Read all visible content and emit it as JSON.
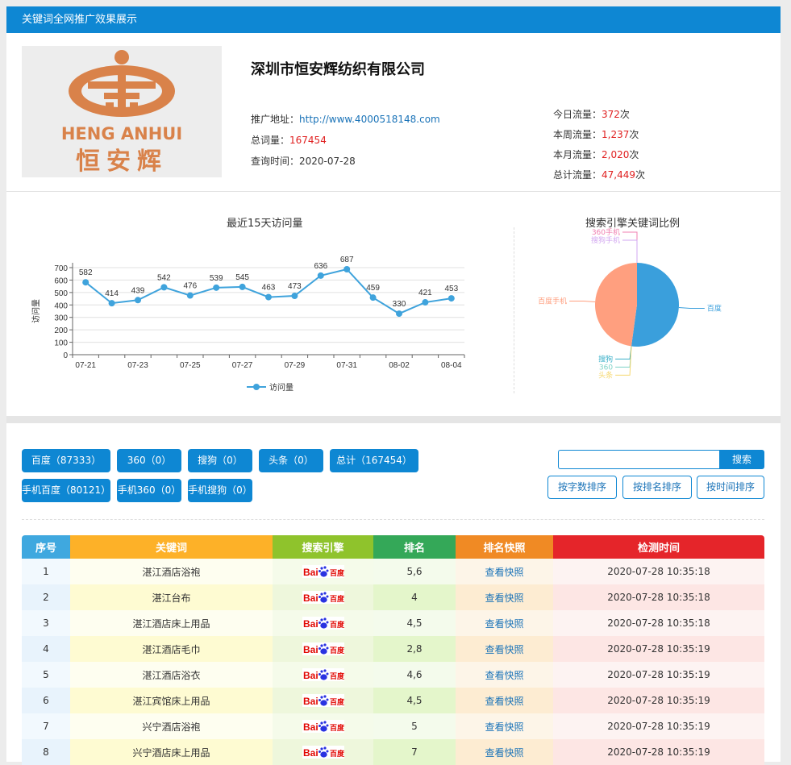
{
  "header": {
    "title": "关键词全网推广效果展示"
  },
  "company": {
    "name": "深圳市恒安辉纺织有限公司",
    "logo_text_en": "HENG ANHUI",
    "logo_text_cn": "恒安辉",
    "url_label": "推广地址：",
    "url": "http://www.4000518148.com",
    "total_words_label": "总词量：",
    "total_words": "167454",
    "query_time_label": "查询时间：",
    "query_time": "2020-07-28"
  },
  "traffic": [
    {
      "label": "今日流量：",
      "value": "372",
      "unit": "次"
    },
    {
      "label": "本周流量：",
      "value": "1,237",
      "unit": "次"
    },
    {
      "label": "本月流量：",
      "value": "2,020",
      "unit": "次"
    },
    {
      "label": "总计流量：",
      "value": "47,449",
      "unit": "次"
    }
  ],
  "chart_data": [
    {
      "type": "line",
      "title": "最近15天访问量",
      "ylabel": "访问量",
      "xlabel": "",
      "x": [
        "07-21",
        "07-22",
        "07-23",
        "07-24",
        "07-25",
        "07-26",
        "07-27",
        "07-28",
        "07-29",
        "07-30",
        "07-31",
        "08-01",
        "08-02",
        "08-03",
        "08-04"
      ],
      "x_tick_labels": [
        "07-21",
        "07-23",
        "07-25",
        "07-27",
        "07-29",
        "07-31",
        "08-02",
        "08-04"
      ],
      "y_ticks": [
        "0",
        "100",
        "200",
        "300",
        "400",
        "500",
        "600",
        "700"
      ],
      "series": [
        {
          "name": "访问量",
          "values": [
            582,
            414,
            439,
            542,
            476,
            539,
            545,
            463,
            473,
            636,
            687,
            459,
            330,
            421,
            453
          ],
          "color": "#3fa3dc"
        }
      ],
      "ylim": [
        0,
        700
      ],
      "grid": true,
      "legend": "bottom-center"
    },
    {
      "type": "pie",
      "title": "搜索引擎关键词比例",
      "slices": [
        {
          "label": "百度",
          "value": 87333,
          "color": "#3a9fdc"
        },
        {
          "label": "360",
          "value": 0,
          "color": "#7fd3c7"
        },
        {
          "label": "搜狗",
          "value": 0,
          "color": "#3ab0c9"
        },
        {
          "label": "头条",
          "value": 0,
          "color": "#f5d76e"
        },
        {
          "label": "百度手机",
          "value": 80121,
          "color": "#ff9f7f"
        },
        {
          "label": "360手机",
          "value": 0,
          "color": "#f07fb0"
        },
        {
          "label": "搜狗手机",
          "value": 0,
          "color": "#d2a7f0"
        }
      ],
      "legend": "none"
    }
  ],
  "filters": {
    "row1": [
      {
        "label": "百度（87333）"
      },
      {
        "label": "360（0）"
      },
      {
        "label": "搜狗（0）"
      },
      {
        "label": "头条（0）"
      },
      {
        "label": "总计（167454）"
      }
    ],
    "row2": [
      {
        "label": "手机百度（80121）"
      },
      {
        "label": "手机360（0）"
      },
      {
        "label": "手机搜狗（0）"
      }
    ]
  },
  "search": {
    "placeholder": "",
    "button": "搜索"
  },
  "sort": [
    {
      "label": "按字数排序"
    },
    {
      "label": "按排名排序"
    },
    {
      "label": "按时间排序"
    }
  ],
  "table": {
    "headers": [
      "序号",
      "关键词",
      "搜索引擎",
      "排名",
      "排名快照",
      "检测时间"
    ],
    "engine_logo": {
      "baidu_en": "Bai",
      "baidu_cn": "百度"
    },
    "snapshot_label": "查看快照",
    "rows": [
      {
        "no": "1",
        "keyword": "湛江酒店浴袍",
        "rank": "5,6",
        "time": "2020-07-28 10:35:18"
      },
      {
        "no": "2",
        "keyword": "湛江台布",
        "rank": "4",
        "time": "2020-07-28 10:35:18"
      },
      {
        "no": "3",
        "keyword": "湛江酒店床上用品",
        "rank": "4,5",
        "time": "2020-07-28 10:35:18"
      },
      {
        "no": "4",
        "keyword": "湛江酒店毛巾",
        "rank": "2,8",
        "time": "2020-07-28 10:35:19"
      },
      {
        "no": "5",
        "keyword": "湛江酒店浴衣",
        "rank": "4,6",
        "time": "2020-07-28 10:35:19"
      },
      {
        "no": "6",
        "keyword": "湛江宾馆床上用品",
        "rank": "4,5",
        "time": "2020-07-28 10:35:19"
      },
      {
        "no": "7",
        "keyword": "兴宁酒店浴袍",
        "rank": "5",
        "time": "2020-07-28 10:35:19"
      },
      {
        "no": "8",
        "keyword": "兴宁酒店床上用品",
        "rank": "7",
        "time": "2020-07-28 10:35:19"
      }
    ]
  }
}
